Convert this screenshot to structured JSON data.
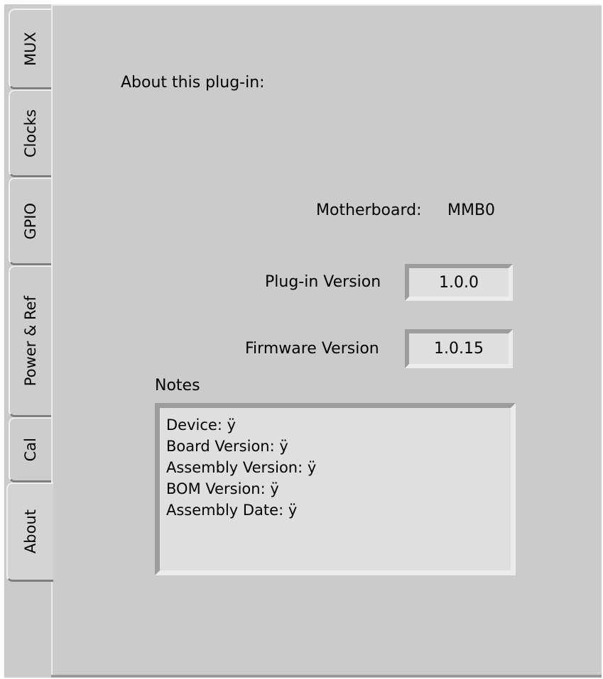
{
  "tabs": [
    {
      "label": "MUX",
      "active": false
    },
    {
      "label": "Clocks",
      "active": false
    },
    {
      "label": "GPIO",
      "active": false
    },
    {
      "label": "Power & Ref",
      "active": false
    },
    {
      "label": "Cal",
      "active": false
    },
    {
      "label": "About",
      "active": true
    }
  ],
  "about": {
    "heading": "About this plug-in:",
    "motherboard_label": "Motherboard:",
    "motherboard_value": "MMB0",
    "plugin_version_label": "Plug-in Version",
    "plugin_version_value": "1.0.0",
    "firmware_version_label": "Firmware Version",
    "firmware_version_value": "1.0.15",
    "notes_label": "Notes",
    "notes_lines": [
      "Device: ÿ",
      "Board Version: ÿ",
      "Assembly Version: ÿ",
      "BOM Version: ÿ",
      "Assembly Date: ÿ"
    ]
  }
}
